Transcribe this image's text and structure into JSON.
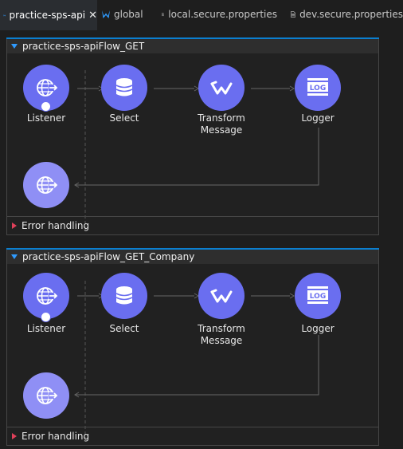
{
  "tabs": [
    {
      "label": "practice-sps-api",
      "icon": "mule-icon",
      "active": true,
      "closable": true
    },
    {
      "label": "global",
      "icon": "mule-icon",
      "active": false
    },
    {
      "label": "local.secure.properties",
      "icon": "file-icon",
      "active": false
    },
    {
      "label": "dev.secure.properties",
      "icon": "file-icon",
      "active": false
    }
  ],
  "flows": [
    {
      "title": "practice-sps-apiFlow_GET",
      "nodes": [
        {
          "label": "Listener",
          "icon": "globe-arrow-icon"
        },
        {
          "label": "Select",
          "icon": "database-icon"
        },
        {
          "label": "Transform Message",
          "label_line1": "Transform",
          "label_line2": "Message",
          "icon": "dataweave-icon"
        },
        {
          "label": "Logger",
          "icon": "log-icon"
        }
      ],
      "response_icon": "globe-arrow-icon",
      "error_handling": "Error handling"
    },
    {
      "title": "practice-sps-apiFlow_GET_Company",
      "nodes": [
        {
          "label": "Listener",
          "icon": "globe-arrow-icon"
        },
        {
          "label": "Select",
          "icon": "database-icon"
        },
        {
          "label": "Transform Message",
          "label_line1": "Transform",
          "label_line2": "Message",
          "icon": "dataweave-icon"
        },
        {
          "label": "Logger",
          "icon": "log-icon"
        }
      ],
      "response_icon": "globe-arrow-icon",
      "error_handling": "Error handling"
    }
  ],
  "colors": {
    "node": "#6a6ef0",
    "node_response": "#8f8ff5",
    "accent": "#0b7fd0",
    "error_marker": "#e0405a",
    "background": "#1e1e1e"
  }
}
